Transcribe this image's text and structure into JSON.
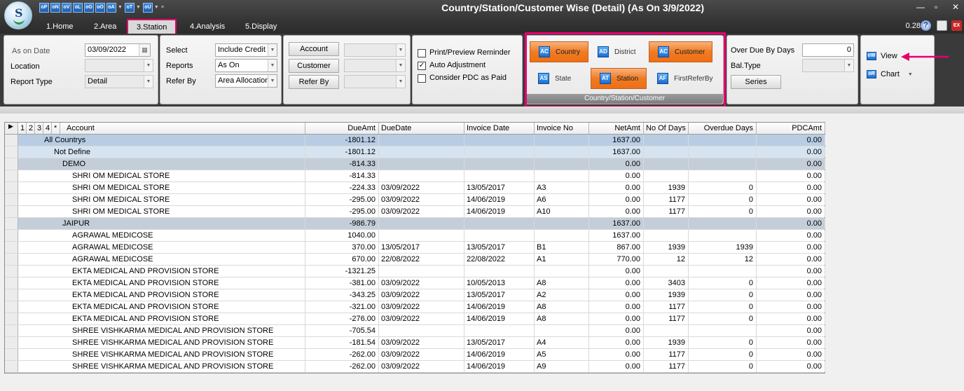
{
  "app": {
    "logo_letter": "S",
    "title": "Country/Station/Customer Wise  (Detail) (As On 3/9/2022)",
    "quick_access": [
      "oP",
      "oN",
      "oV",
      "oL",
      "oG",
      "oO",
      "oA",
      "oT",
      "oU"
    ],
    "min": "—",
    "max": "▫",
    "close": "✕",
    "elapsed": "0.28"
  },
  "menu_tabs": [
    "1.Home",
    "2.Area",
    "3.Station",
    "4.Analysis",
    "5.Display"
  ],
  "filters": {
    "as_on_label": "As on Date",
    "as_on_value": "03/09/2022",
    "location_label": "Location",
    "location_value": "",
    "report_type_label": "Report Type",
    "report_type_value": "Detail",
    "select_label": "Select",
    "select_value": "Include Credit I",
    "reports_label": "Reports",
    "reports_value": "As On",
    "refer_by_label": "Refer By",
    "refer_by_value": "Area Allocation"
  },
  "party": {
    "account_btn": "Account",
    "customer_btn": "Customer",
    "refer_btn": "Refer By"
  },
  "options": {
    "print_preview": {
      "label": "Print/Preview Reminder",
      "checked": false
    },
    "auto_adjust": {
      "label": "Auto Adjustment",
      "checked": true
    },
    "consider_pdc": {
      "label": "Consider PDC as Paid",
      "checked": false
    }
  },
  "grouping": {
    "footer": "Country/Station/Customer",
    "buttons": [
      {
        "label": "Country",
        "active": true,
        "icon": "AC"
      },
      {
        "label": "District",
        "active": false,
        "icon": "AD"
      },
      {
        "label": "Customer",
        "active": true,
        "icon": "AC"
      },
      {
        "label": "State",
        "active": false,
        "icon": "AS"
      },
      {
        "label": "Station",
        "active": true,
        "icon": "AT"
      },
      {
        "label": "FirstReferBy",
        "active": false,
        "icon": "AF"
      }
    ]
  },
  "overdue": {
    "label": "Over Due By Days",
    "value": "0",
    "baltype_label": "Bal.Type",
    "baltype_value": "",
    "series_btn": "Series"
  },
  "output": {
    "view": "View",
    "chart": "Chart"
  },
  "grid": {
    "level_tabs": [
      "1",
      "2",
      "3",
      "4",
      "*"
    ],
    "headers": [
      "Account",
      "DueAmt",
      "DueDate",
      "Invoice Date",
      "Invoice No",
      "NetAmt",
      "No Of Days",
      "Overdue Days",
      "PDCAmt"
    ],
    "rows": [
      {
        "level": 0,
        "account": "All Countrys",
        "due_amt": "-1801.12",
        "due_date": "",
        "invoice_date": "",
        "invoice_no": "",
        "net_amt": "1637.00",
        "no_of_days": "",
        "overdue_days": "",
        "pdc_amt": "0.00"
      },
      {
        "level": 1,
        "account": "Not Define",
        "due_amt": "-1801.12",
        "due_date": "",
        "invoice_date": "",
        "invoice_no": "",
        "net_amt": "1637.00",
        "no_of_days": "",
        "overdue_days": "",
        "pdc_amt": "0.00"
      },
      {
        "level": 2,
        "account": "DEMO",
        "due_amt": "-814.33",
        "due_date": "",
        "invoice_date": "",
        "invoice_no": "",
        "net_amt": "0.00",
        "no_of_days": "",
        "overdue_days": "",
        "pdc_amt": "0.00"
      },
      {
        "level": 3,
        "account": "SHRI OM MEDICAL STORE",
        "due_amt": "-814.33",
        "due_date": "",
        "invoice_date": "",
        "invoice_no": "",
        "net_amt": "0.00",
        "no_of_days": "",
        "overdue_days": "",
        "pdc_amt": "0.00"
      },
      {
        "level": 3,
        "account": "SHRI OM MEDICAL STORE",
        "due_amt": "-224.33",
        "due_date": "03/09/2022",
        "invoice_date": "13/05/2017",
        "invoice_no": "A3",
        "net_amt": "0.00",
        "no_of_days": "1939",
        "overdue_days": "0",
        "pdc_amt": "0.00"
      },
      {
        "level": 3,
        "account": "SHRI OM MEDICAL STORE",
        "due_amt": "-295.00",
        "due_date": "03/09/2022",
        "invoice_date": "14/06/2019",
        "invoice_no": "A6",
        "net_amt": "0.00",
        "no_of_days": "1177",
        "overdue_days": "0",
        "pdc_amt": "0.00"
      },
      {
        "level": 3,
        "account": "SHRI OM MEDICAL STORE",
        "due_amt": "-295.00",
        "due_date": "03/09/2022",
        "invoice_date": "14/06/2019",
        "invoice_no": "A10",
        "net_amt": "0.00",
        "no_of_days": "1177",
        "overdue_days": "0",
        "pdc_amt": "0.00"
      },
      {
        "level": 2,
        "account": "JAIPUR",
        "due_amt": "-986.79",
        "due_date": "",
        "invoice_date": "",
        "invoice_no": "",
        "net_amt": "1637.00",
        "no_of_days": "",
        "overdue_days": "",
        "pdc_amt": "0.00"
      },
      {
        "level": 3,
        "account": "AGRAWAL MEDICOSE",
        "due_amt": "1040.00",
        "due_date": "",
        "invoice_date": "",
        "invoice_no": "",
        "net_amt": "1637.00",
        "no_of_days": "",
        "overdue_days": "",
        "pdc_amt": "0.00"
      },
      {
        "level": 3,
        "account": "AGRAWAL MEDICOSE",
        "due_amt": "370.00",
        "due_date": "13/05/2017",
        "invoice_date": "13/05/2017",
        "invoice_no": "B1",
        "net_amt": "867.00",
        "no_of_days": "1939",
        "overdue_days": "1939",
        "pdc_amt": "0.00"
      },
      {
        "level": 3,
        "account": "AGRAWAL MEDICOSE",
        "due_amt": "670.00",
        "due_date": "22/08/2022",
        "invoice_date": "22/08/2022",
        "invoice_no": "A1",
        "net_amt": "770.00",
        "no_of_days": "12",
        "overdue_days": "12",
        "pdc_amt": "0.00"
      },
      {
        "level": 3,
        "account": "EKTA MEDICAL AND PROVISION STORE",
        "due_amt": "-1321.25",
        "due_date": "",
        "invoice_date": "",
        "invoice_no": "",
        "net_amt": "0.00",
        "no_of_days": "",
        "overdue_days": "",
        "pdc_amt": "0.00"
      },
      {
        "level": 3,
        "account": "EKTA MEDICAL AND PROVISION STORE",
        "due_amt": "-381.00",
        "due_date": "03/09/2022",
        "invoice_date": "10/05/2013",
        "invoice_no": "A8",
        "net_amt": "0.00",
        "no_of_days": "3403",
        "overdue_days": "0",
        "pdc_amt": "0.00"
      },
      {
        "level": 3,
        "account": "EKTA MEDICAL AND PROVISION STORE",
        "due_amt": "-343.25",
        "due_date": "03/09/2022",
        "invoice_date": "13/05/2017",
        "invoice_no": "A2",
        "net_amt": "0.00",
        "no_of_days": "1939",
        "overdue_days": "0",
        "pdc_amt": "0.00"
      },
      {
        "level": 3,
        "account": "EKTA MEDICAL AND PROVISION STORE",
        "due_amt": "-321.00",
        "due_date": "03/09/2022",
        "invoice_date": "14/06/2019",
        "invoice_no": "A8",
        "net_amt": "0.00",
        "no_of_days": "1177",
        "overdue_days": "0",
        "pdc_amt": "0.00"
      },
      {
        "level": 3,
        "account": "EKTA MEDICAL AND PROVISION STORE",
        "due_amt": "-276.00",
        "due_date": "03/09/2022",
        "invoice_date": "14/06/2019",
        "invoice_no": "A8",
        "net_amt": "0.00",
        "no_of_days": "1177",
        "overdue_days": "0",
        "pdc_amt": "0.00"
      },
      {
        "level": 3,
        "account": "SHREE VISHKARMA MEDICAL AND PROVISION STORE",
        "due_amt": "-705.54",
        "due_date": "",
        "invoice_date": "",
        "invoice_no": "",
        "net_amt": "0.00",
        "no_of_days": "",
        "overdue_days": "",
        "pdc_amt": "0.00"
      },
      {
        "level": 3,
        "account": "SHREE VISHKARMA MEDICAL AND PROVISION STORE",
        "due_amt": "-181.54",
        "due_date": "03/09/2022",
        "invoice_date": "13/05/2017",
        "invoice_no": "A4",
        "net_amt": "0.00",
        "no_of_days": "1939",
        "overdue_days": "0",
        "pdc_amt": "0.00"
      },
      {
        "level": 3,
        "account": "SHREE VISHKARMA MEDICAL AND PROVISION STORE",
        "due_amt": "-262.00",
        "due_date": "03/09/2022",
        "invoice_date": "14/06/2019",
        "invoice_no": "A5",
        "net_amt": "0.00",
        "no_of_days": "1177",
        "overdue_days": "0",
        "pdc_amt": "0.00"
      },
      {
        "level": 3,
        "account": "SHREE VISHKARMA MEDICAL AND PROVISION STORE",
        "due_amt": "-262.00",
        "due_date": "03/09/2022",
        "invoice_date": "14/06/2019",
        "invoice_no": "A9",
        "net_amt": "0.00",
        "no_of_days": "1177",
        "overdue_days": "0",
        "pdc_amt": "0.00"
      }
    ]
  },
  "colors": {
    "accent": "#e6006e",
    "active_orange": "#f07b24",
    "grid_level0": "#b8cde4"
  }
}
